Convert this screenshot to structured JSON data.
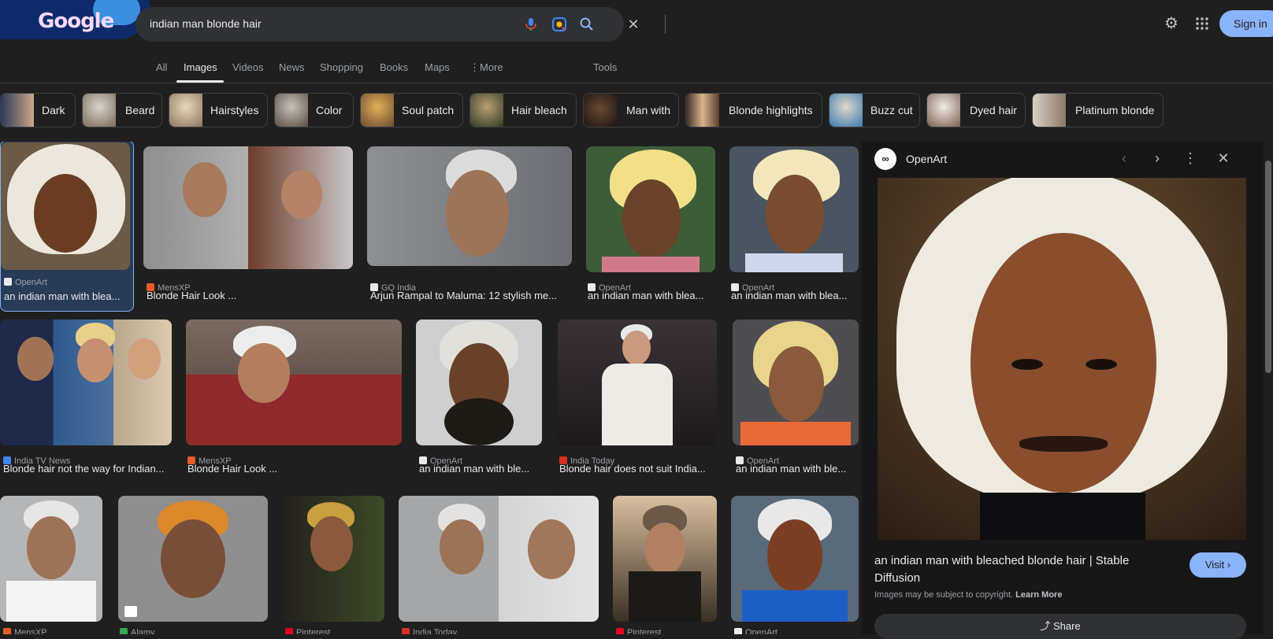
{
  "search": {
    "query": "indian man blonde hair"
  },
  "header": {
    "logo": "Google",
    "sign_in": "Sign in"
  },
  "nav": {
    "tabs": [
      "All",
      "Images",
      "Videos",
      "News",
      "Shopping",
      "Books",
      "Maps",
      "More"
    ],
    "tools": "Tools"
  },
  "chips": [
    "Dark",
    "Beard",
    "Hairstyles",
    "Color",
    "Soul patch",
    "Hair bleach",
    "Man with",
    "Blonde highlights",
    "Buzz cut",
    "Dyed hair",
    "Platinum blonde"
  ],
  "results": [
    {
      "source": "OpenArt",
      "title": "an indian man with blea..."
    },
    {
      "source": "MensXP",
      "title": "Blonde Hair Look ..."
    },
    {
      "source": "GQ India",
      "title": "Arjun Rampal to Maluma: 12 stylish me..."
    },
    {
      "source": "OpenArt",
      "title": "an indian man with blea..."
    },
    {
      "source": "OpenArt",
      "title": "an indian man with blea..."
    },
    {
      "source": "India TV News",
      "title": "Blonde hair not the way for Indian..."
    },
    {
      "source": "MensXP",
      "title": "Blonde Hair Look ..."
    },
    {
      "source": "OpenArt",
      "title": "an indian man with ble..."
    },
    {
      "source": "India Today",
      "title": "Blonde hair does not suit India..."
    },
    {
      "source": "OpenArt",
      "title": "an indian man with ble..."
    },
    {
      "source": "MensXP",
      "title": ""
    },
    {
      "source": "Alamy",
      "title": ""
    },
    {
      "source": "Pinterest",
      "title": ""
    },
    {
      "source": "India Today",
      "title": ""
    },
    {
      "source": "Pinterest",
      "title": ""
    },
    {
      "source": "OpenArt",
      "title": ""
    }
  ],
  "panel": {
    "source": "OpenArt",
    "title": "an indian man with bleached blonde hair | Stable Diffusion",
    "visit": "Visit",
    "copyright": "Images may be subject to copyright.",
    "learn_more": "Learn More",
    "share": "Share"
  },
  "colors": {
    "accent": "#8ab4f8",
    "background": "#1f1f1f"
  }
}
